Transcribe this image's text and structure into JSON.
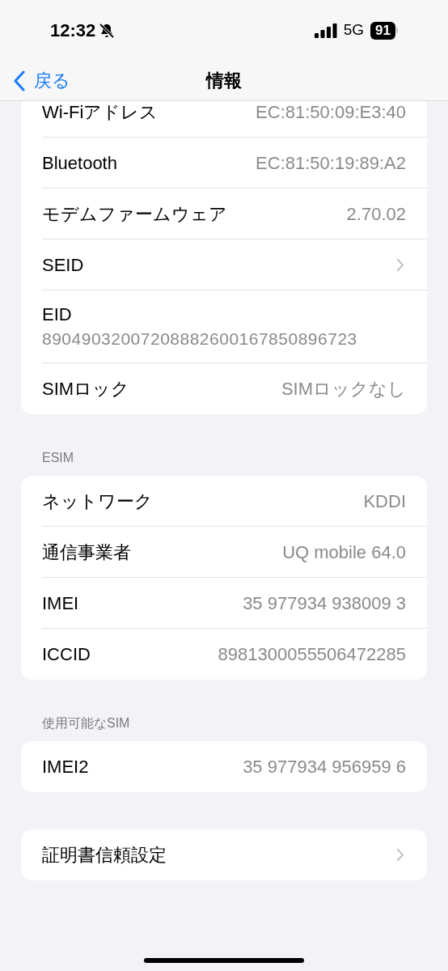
{
  "status_bar": {
    "time": "12:32",
    "network": "5G",
    "battery": "91",
    "silent": true
  },
  "nav": {
    "back": "戻る",
    "title": "情報"
  },
  "groups": [
    {
      "rows": [
        {
          "kind": "value",
          "label": "Wi-Fiアドレス",
          "value": "EC:81:50:09:E3:40"
        },
        {
          "kind": "value",
          "label": "Bluetooth",
          "value": "EC:81:50:19:89:A2"
        },
        {
          "kind": "value",
          "label": "モデムファームウェア",
          "value": "2.70.02"
        },
        {
          "kind": "chevron",
          "label": "SEID"
        },
        {
          "kind": "stacked",
          "label": "EID",
          "value": "89049032007208882600167850896723"
        },
        {
          "kind": "value",
          "label": "SIMロック",
          "value": "SIMロックなし"
        }
      ]
    },
    {
      "header": "ESIM",
      "rows": [
        {
          "kind": "value",
          "label": "ネットワーク",
          "value": "KDDI"
        },
        {
          "kind": "value",
          "label": "通信事業者",
          "value": "UQ mobile 64.0"
        },
        {
          "kind": "value",
          "label": "IMEI",
          "value": "35 977934 938009 3"
        },
        {
          "kind": "value",
          "label": "ICCID",
          "value": "8981300055506472285"
        }
      ]
    },
    {
      "header": "使用可能なSIM",
      "rows": [
        {
          "kind": "value",
          "label": "IMEI2",
          "value": "35 977934 956959 6"
        }
      ]
    },
    {
      "rows": [
        {
          "kind": "chevron",
          "label": "証明書信頼設定"
        }
      ]
    }
  ]
}
